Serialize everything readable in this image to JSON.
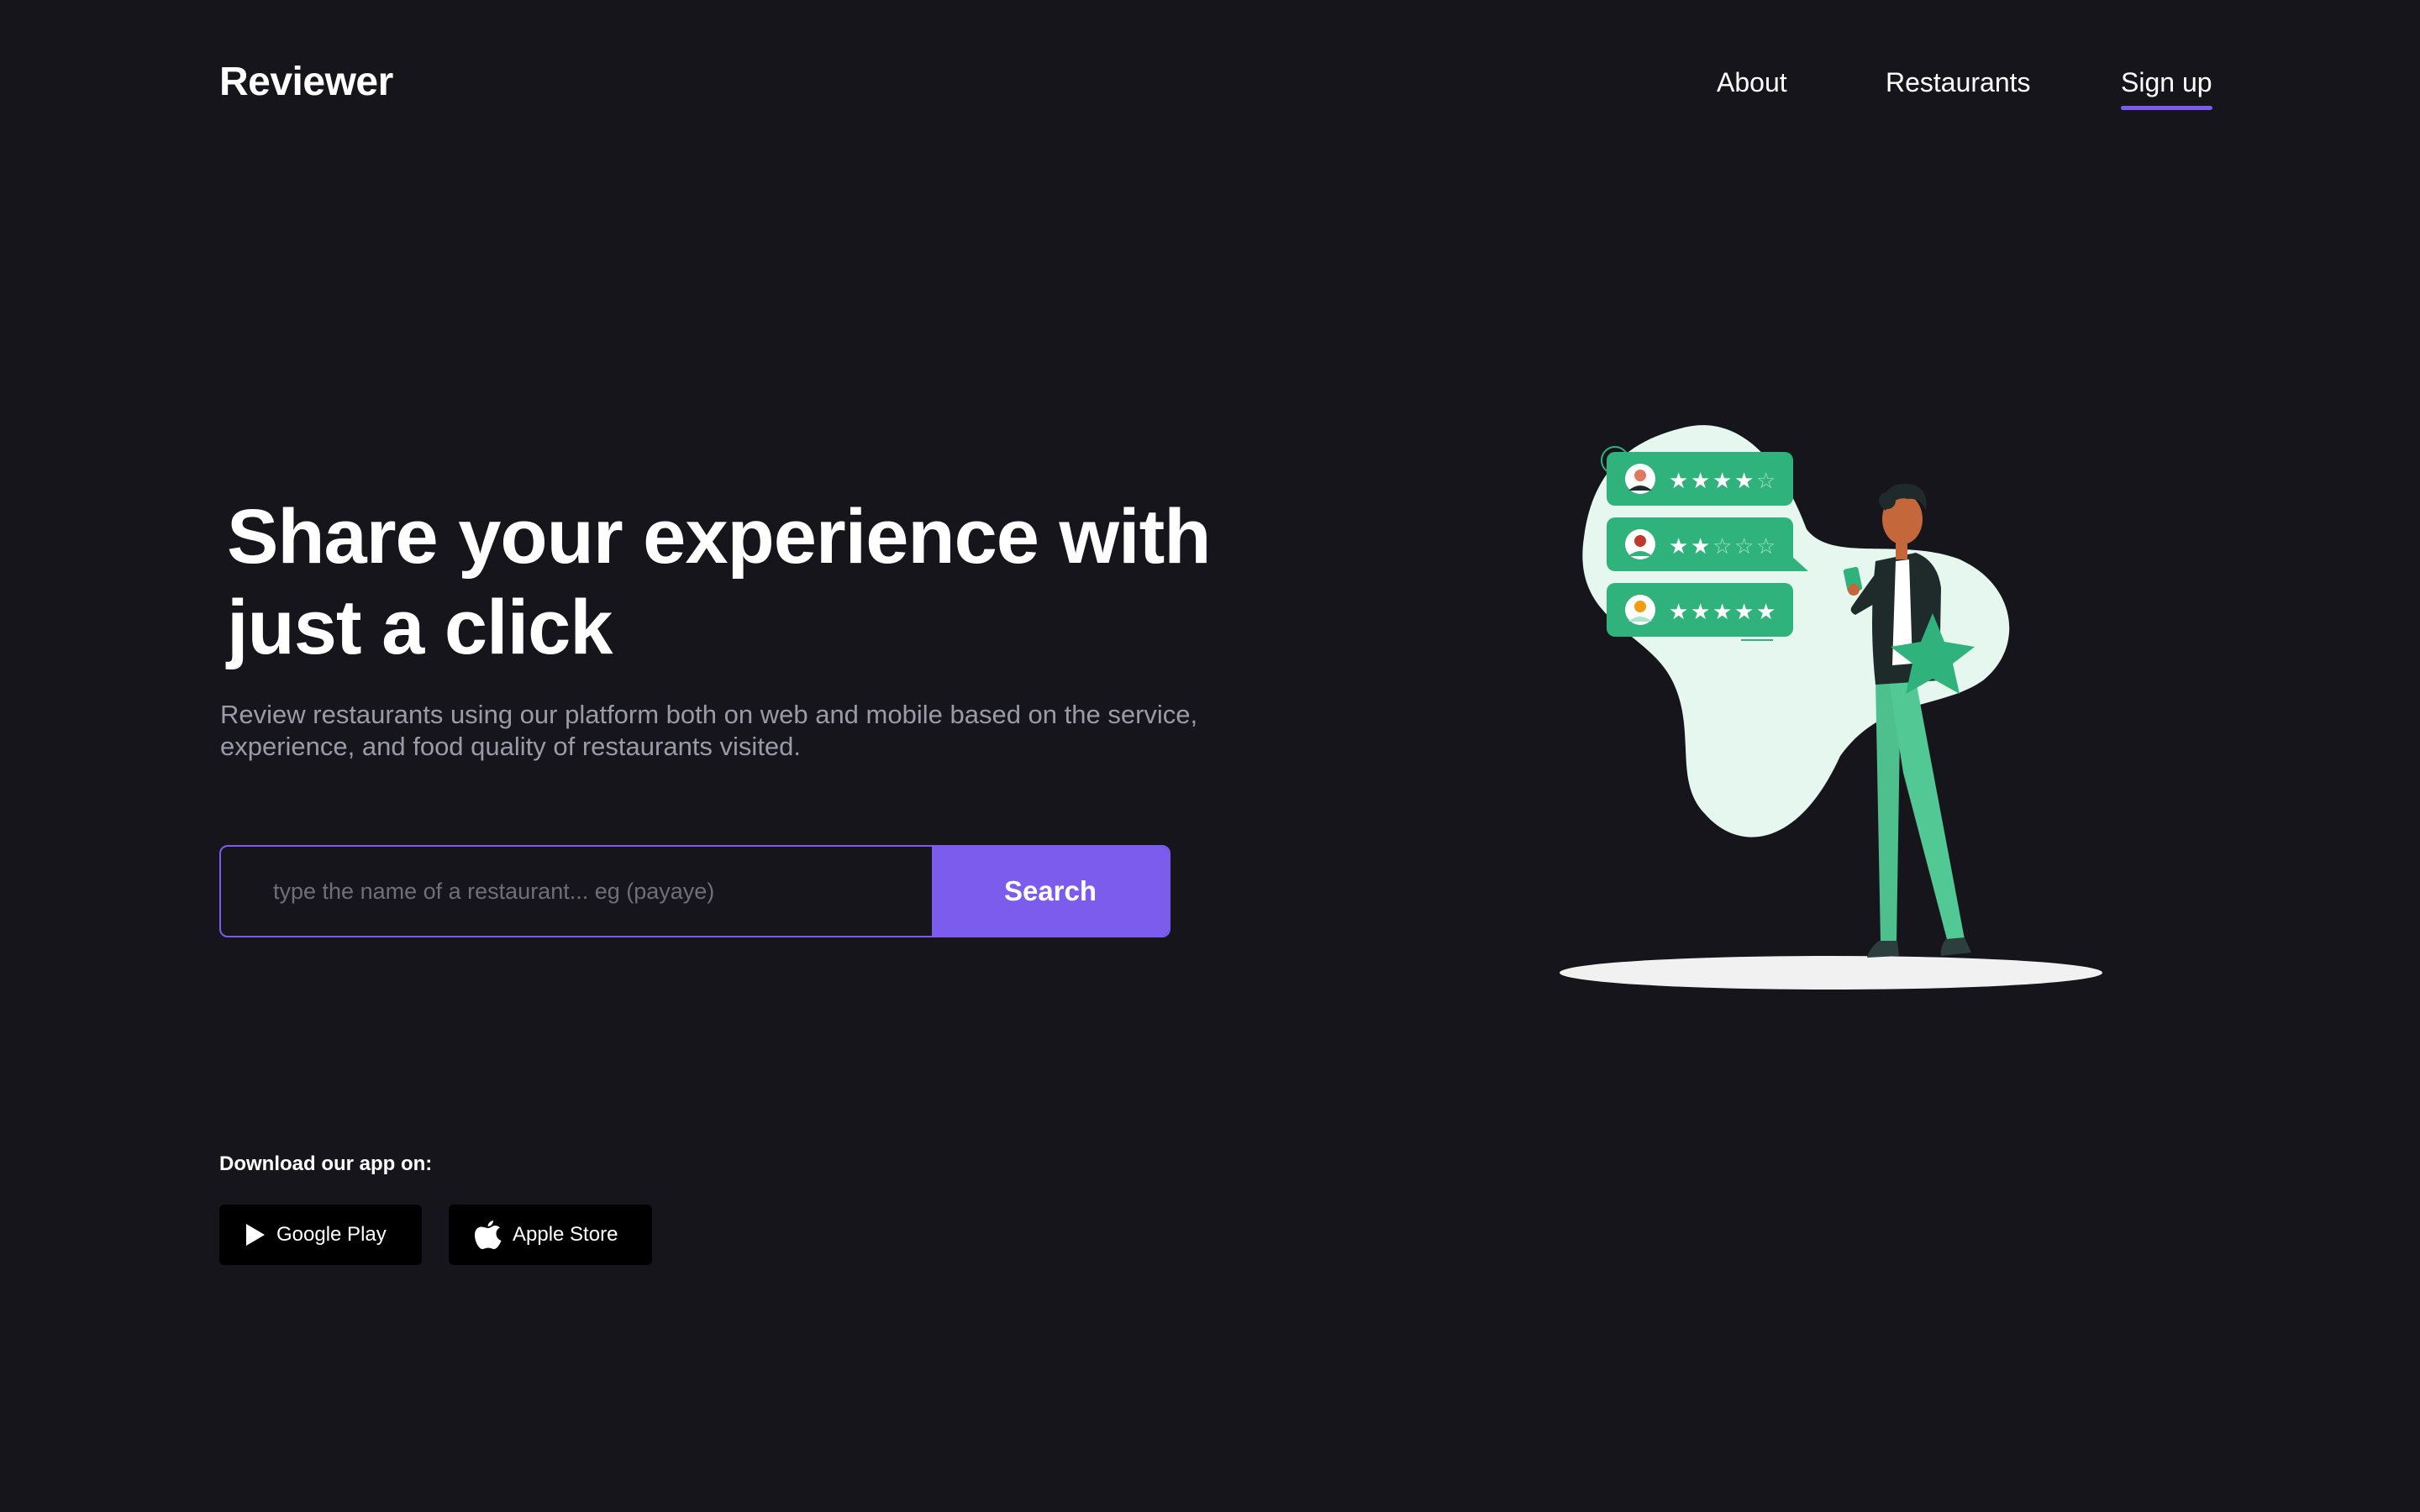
{
  "header": {
    "logo": "Reviewer",
    "nav": {
      "about": "About",
      "restaurants": "Restaurants",
      "signup": "Sign up"
    }
  },
  "hero": {
    "headline_line1": "Share your experience with",
    "headline_line2": "just a click",
    "subtext_line1": "Review restaurants using our platform both on web and mobile based on the service,",
    "subtext_line2": "experience, and food quality of restaurants visited."
  },
  "search": {
    "placeholder": "type the name of a restaurant... eg (payaye)",
    "value": "",
    "button_label": "Search"
  },
  "download": {
    "label": "Download our app on:",
    "google_play": "Google Play",
    "apple_store": "Apple Store"
  },
  "illustration": {
    "review_cards": [
      {
        "rating": 4,
        "out_of": 5
      },
      {
        "rating": 2,
        "out_of": 5
      },
      {
        "rating": 5,
        "out_of": 5
      }
    ]
  },
  "colors": {
    "background": "#16151b",
    "accent": "#7c5ced",
    "card_green": "#2fb27b",
    "blob_mint": "#e6f7ef",
    "muted_text": "#9b9aa8"
  }
}
